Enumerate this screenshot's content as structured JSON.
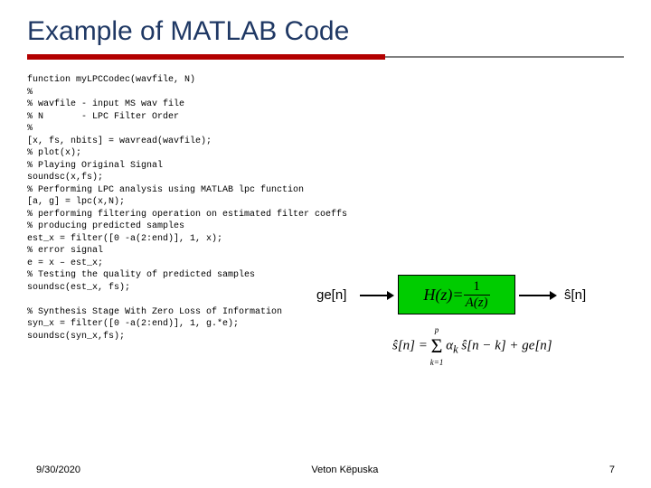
{
  "title": "Example of MATLAB Code",
  "code_lines": [
    "function myLPCCodec(wavfile, N)",
    "%",
    "% wavfile - input MS wav file",
    "% N       - LPC Filter Order",
    "%",
    "[x, fs, nbits] = wavread(wavfile);",
    "% plot(x);",
    "% Playing Original Signal",
    "soundsc(x,fs);",
    "% Performing LPC analysis using MATLAB lpc function",
    "[a, g] = lpc(x,N);",
    "% performing filtering operation on estimated filter coeffs",
    "% producing predicted samples",
    "est_x = filter([0 -a(2:end)], 1, x);",
    "% error signal",
    "e = x – est_x;",
    "% Testing the quality of predicted samples",
    "soundsc(est_x, fs);",
    "",
    "% Synthesis Stage With Zero Loss of Information",
    "syn_x = filter([0 -a(2:end)], 1, g.*e);",
    "soundsc(syn_x,fs);"
  ],
  "diagram": {
    "input_label": "ge[n]",
    "output_label": "ŝ[n]",
    "box_lhs": "H(z)=",
    "box_num": "1",
    "box_den": "A(z)"
  },
  "equation": {
    "lhs": "ŝ[n] = ",
    "sum_top": "p",
    "sum_bottom": "k=1",
    "term1": "α",
    "term1_sub": "k",
    "term1_arg": " ŝ[n − k] + ge[n]"
  },
  "footer": {
    "left": "9/30/2020",
    "center": "Veton Këpuska",
    "right": "7"
  }
}
